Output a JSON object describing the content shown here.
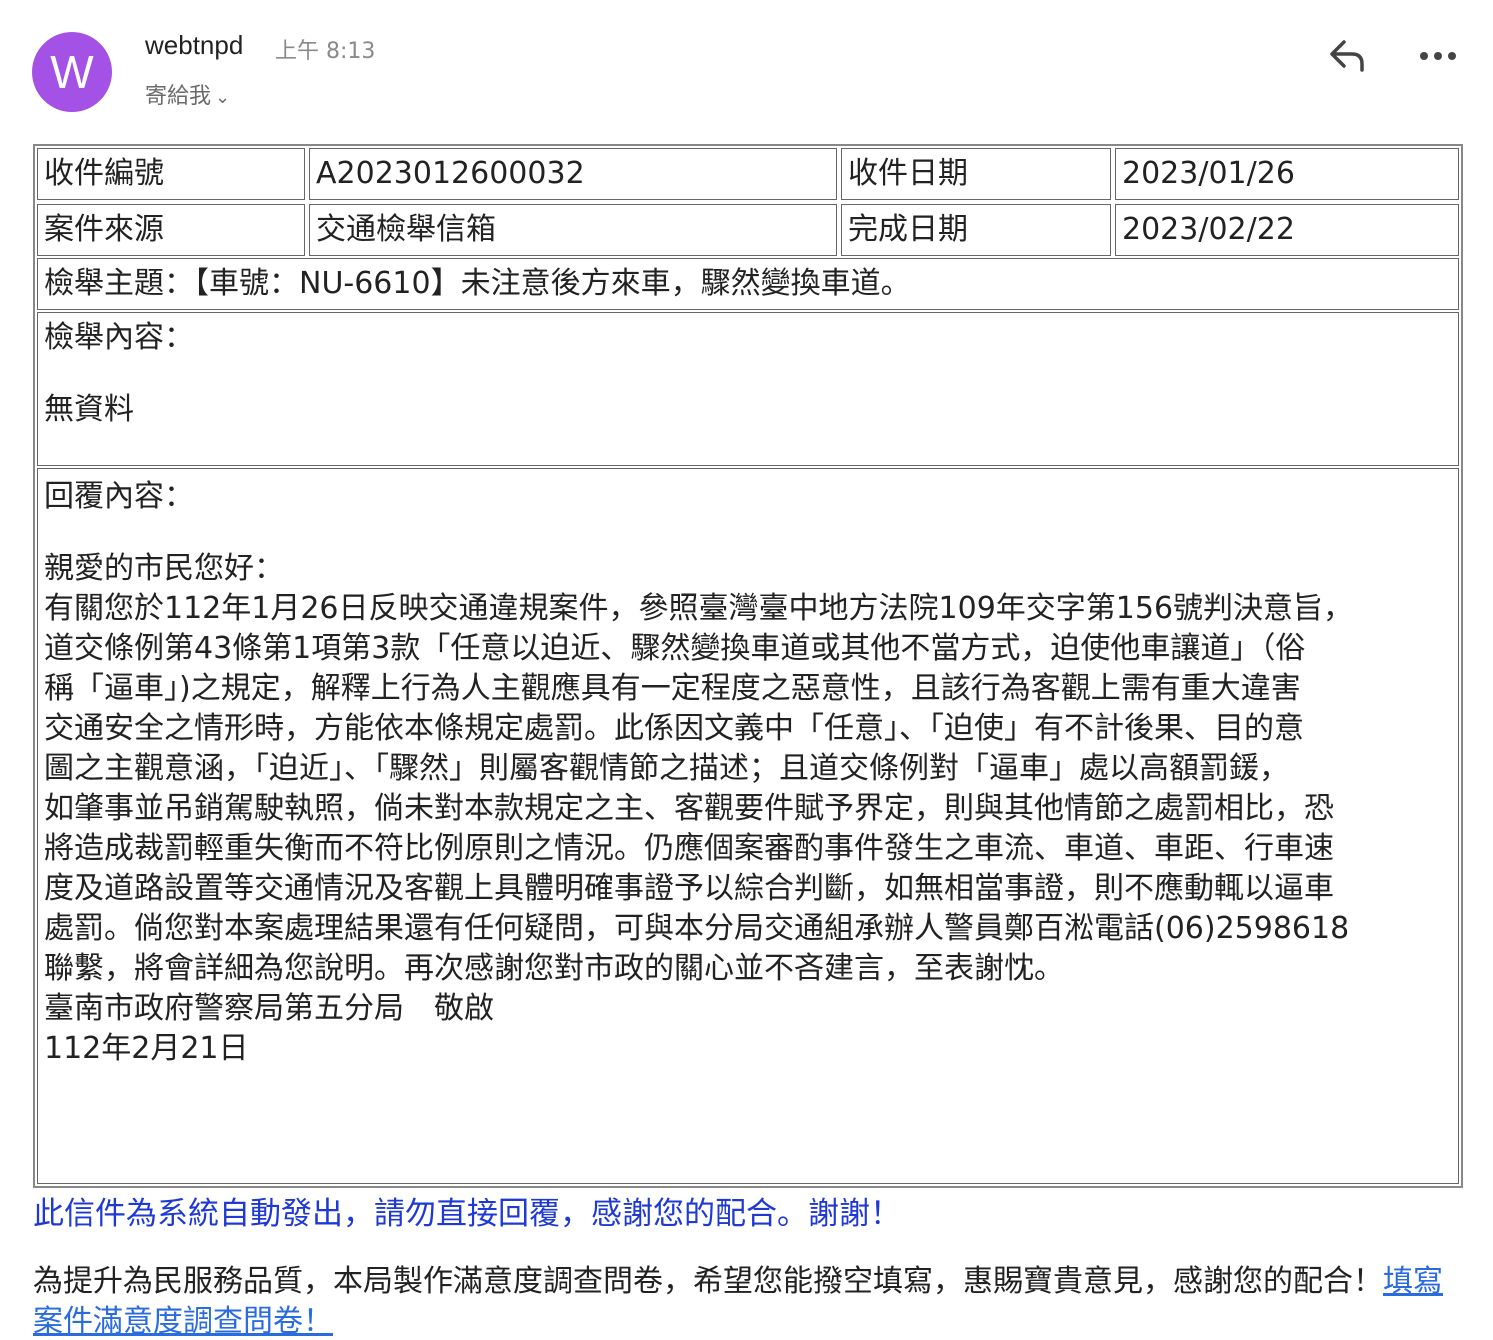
{
  "header": {
    "avatar_letter": "W",
    "avatar_color": "#a451e6",
    "sender": "webtnpd",
    "time": "上午 8:13",
    "recipient": "寄給我",
    "recipient_chevron": "⌄"
  },
  "table": {
    "case_no_label": "收件編號",
    "case_no_value": "A2023012600032",
    "received_label": "收件日期",
    "received_value": "2023/01/26",
    "source_label": "案件來源",
    "source_value": "交通檢舉信箱",
    "completed_label": "完成日期",
    "completed_value": "2023/02/22",
    "subject": "檢舉主題：【車號：NU-6610】未注意後方來車，驟然變換車道。",
    "content_label": "檢舉內容：",
    "content_value": "無資料",
    "reply_label": "回覆內容：",
    "reply_greeting": "親愛的市民您好：",
    "reply_lines": [
      "有關您於112年1月26日反映交通違規案件，參照臺灣臺中地方法院109年交字第156號判決意旨，",
      "道交條例第43條第1項第3款「任意以迫近、驟然變換車道或其他不當方式，迫使他車讓道」（俗",
      "稱「逼車」)之規定，解釋上行為人主觀應具有一定程度之惡意性，且該行為客觀上需有重大違害",
      "交通安全之情形時，方能依本條規定處罰。此係因文義中「任意」、「迫使」有不計後果、目的意",
      "圖之主觀意涵，「迫近」、「驟然」則屬客觀情節之描述；且道交條例對「逼車」處以高額罰鍰，",
      "如肇事並吊銷駕駛執照，倘未對本款規定之主、客觀要件賦予界定，則與其他情節之處罰相比，恐",
      "將造成裁罰輕重失衡而不符比例原則之情況。仍應個案審酌事件發生之車流、車道、車距、行車速",
      "度及道路設置等交通情況及客觀上具體明確事證予以綜合判斷，如無相當事證，則不應動輒以逼車",
      "處罰。倘您對本案處理結果還有任何疑問，可與本分局交通組承辦人警員鄭百淞電話(06)2598618",
      "聯繫，將會詳細為您說明。再次感謝您對市政的關心並不吝建言，至表謝忱。"
    ],
    "reply_signature": "臺南市政府警察局第五分局　敬啟",
    "reply_date": "112年2月21日"
  },
  "footer": {
    "notice": "此信件為系統自動發出，請勿直接回覆，感謝您的配合。謝謝！",
    "notice_color": "#1f39d4",
    "survey_text": "為提升為民服務品質，本局製作滿意度調查問卷，希望您能撥空填寫，惠賜寶貴意見，感謝您的配合！",
    "survey_link": "填寫案件滿意度調查問卷！"
  }
}
